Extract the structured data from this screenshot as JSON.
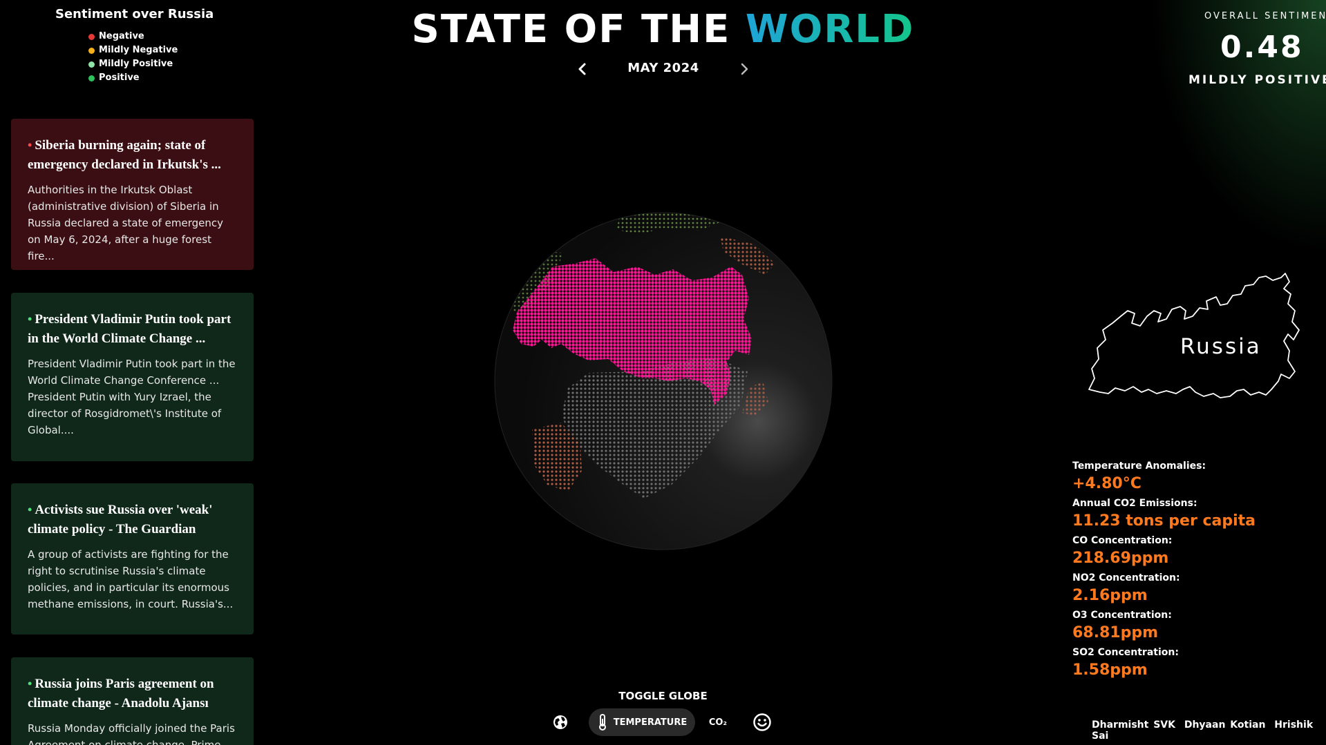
{
  "legend": {
    "title": "Sentiment over Russia",
    "items": [
      {
        "label": "Negative",
        "color": "#e53935"
      },
      {
        "label": "Mildly Negative",
        "color": "#f5b01c"
      },
      {
        "label": "Mildly Positive",
        "color": "#8fe3a6"
      },
      {
        "label": "Positive",
        "color": "#2ec05a"
      }
    ]
  },
  "news": [
    {
      "sentiment": "negative",
      "title": "Siberia burning again; state of emergency declared in Irkutsk's ...",
      "body": "Authorities in the Irkutsk Oblast (administrative division) of Siberia in Russia declared a state of emergency on May 6, 2024, after a huge forest fire..."
    },
    {
      "sentiment": "positive",
      "title": "President Vladimir Putin took part in the World Climate Change ...",
      "body": "President Vladimir Putin took part in the World Climate Change Conference ... President Putin with Yury Izrael, the director of Rosgidromet\\'s Institute of Global...."
    },
    {
      "sentiment": "positive",
      "title": "Activists sue Russia over 'weak' climate policy - The Guardian",
      "body": "A group of activists are fighting for the right to scrutinise Russia's climate policies, and in particular its enormous methane emissions, in court. Russia's..."
    },
    {
      "sentiment": "positive",
      "title": "Russia joins Paris agreement on climate change - Anadolu Ajansı",
      "body": "Russia Monday officially joined the Paris Agreement on climate change. Prime"
    }
  ],
  "header": {
    "title_main": "STATE OF THE ",
    "title_accent": "WORLD",
    "date": "MAY 2024"
  },
  "sentiment": {
    "label": "OVERALL SENTIMENT",
    "score": "0.48",
    "text": "MILDLY POSITIVE"
  },
  "country": {
    "name": "Russia"
  },
  "stats": [
    {
      "label": "Temperature Anomalies:",
      "value": "+4.80°C"
    },
    {
      "label": "Annual CO2 Emissions:",
      "value": "11.23 tons per capita"
    },
    {
      "label": "CO Concentration:",
      "value": "218.69ppm"
    },
    {
      "label": "NO2 Concentration:",
      "value": "2.16ppm"
    },
    {
      "label": "O3 Concentration:",
      "value": "68.81ppm"
    },
    {
      "label": "SO2 Concentration:",
      "value": "1.58ppm"
    }
  ],
  "toggle": {
    "title": "TOGGLE GLOBE",
    "active_label": "TEMPERATURE",
    "co2_label": "CO₂"
  },
  "credits": [
    "Dharmisht SVK",
    "Dhyaan Kotian",
    "Hrishik Sai"
  ],
  "colors": {
    "highlight": "#ff1493",
    "stat_value": "#ff7a1f",
    "accent_start": "#1fa4d8",
    "accent_end": "#14c58b"
  },
  "icons": {
    "prev": "chevron-left-icon",
    "next": "chevron-right-icon",
    "globe": "globe-icon",
    "temperature": "thermometer-icon",
    "sentiment": "smiley-icon"
  }
}
